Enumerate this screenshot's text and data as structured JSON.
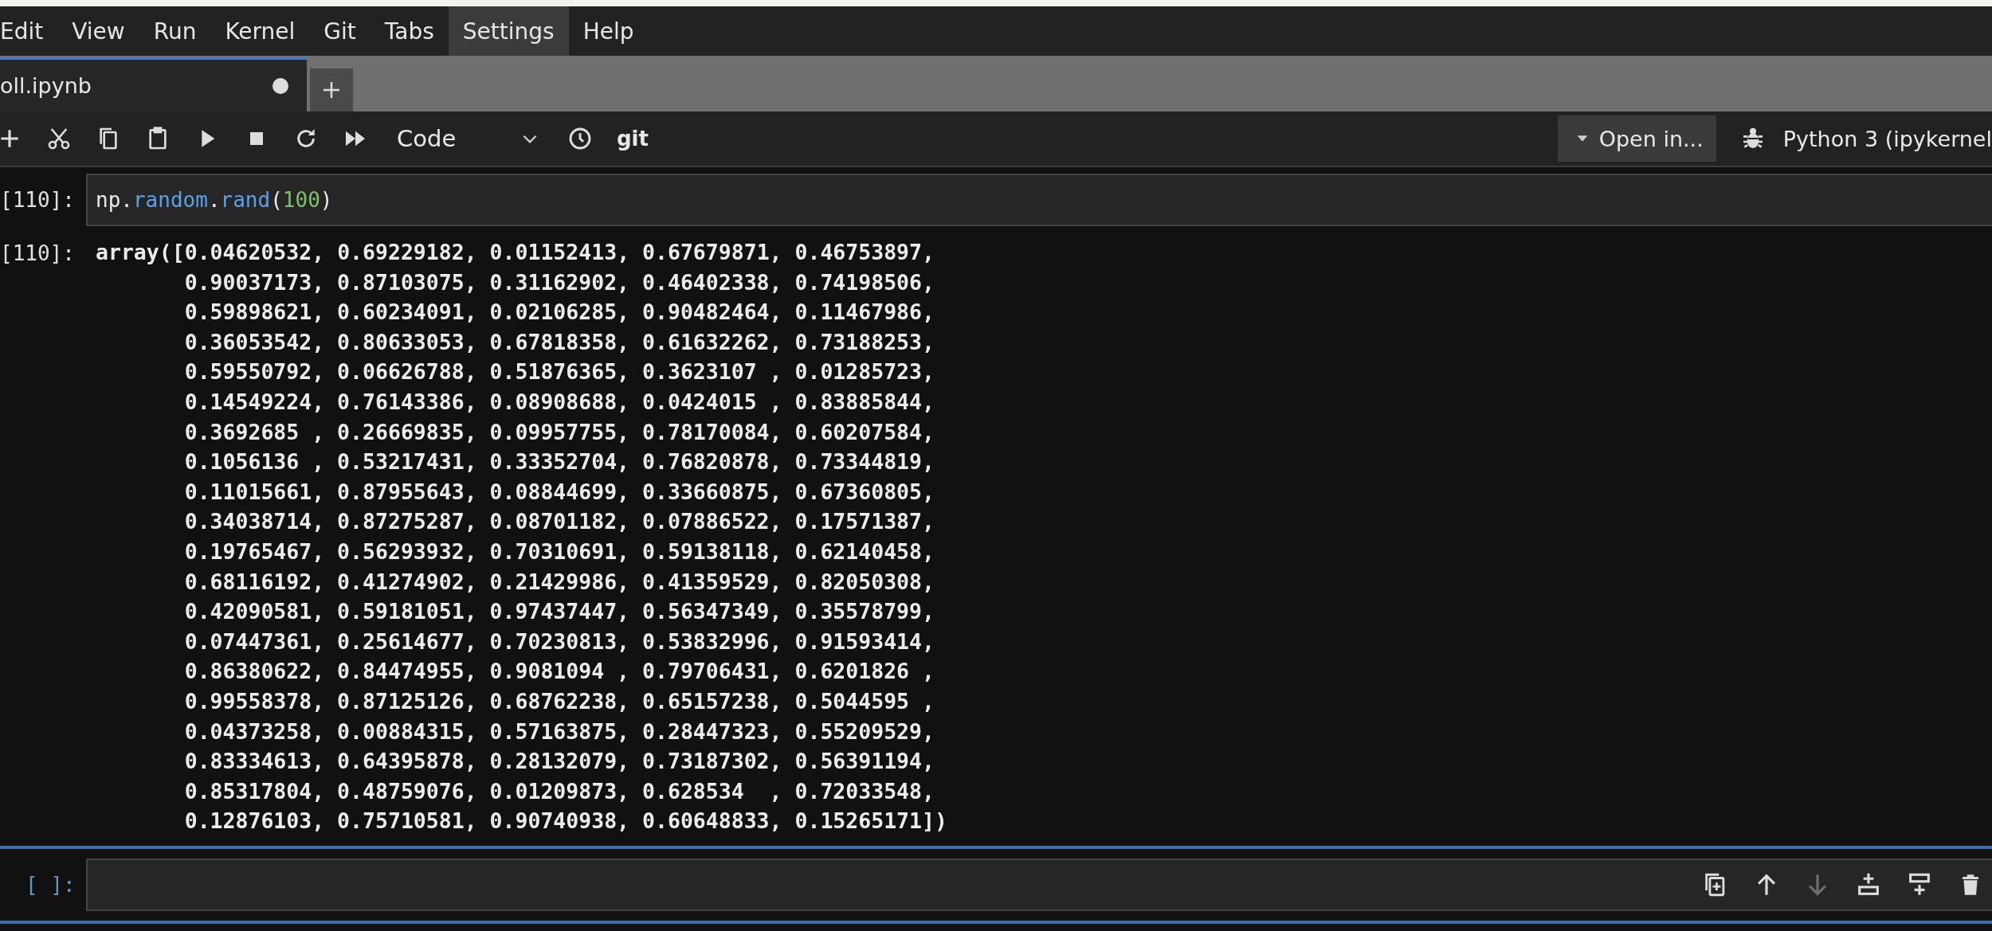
{
  "menu_bar": {
    "items": [
      {
        "label": "Edit",
        "selected": false
      },
      {
        "label": "View",
        "selected": false
      },
      {
        "label": "Run",
        "selected": false
      },
      {
        "label": "Kernel",
        "selected": false
      },
      {
        "label": "Git",
        "selected": false
      },
      {
        "label": "Tabs",
        "selected": false
      },
      {
        "label": "Settings",
        "selected": true
      },
      {
        "label": "Help",
        "selected": false
      }
    ]
  },
  "tab_bar": {
    "tabs": [
      {
        "label": "oll.ipynb",
        "selected": true,
        "unsaved": true
      }
    ]
  },
  "toolbar": {
    "tools": [
      {
        "kind": "add"
      },
      {
        "kind": "cut"
      },
      {
        "kind": "copy"
      },
      {
        "kind": "paste"
      },
      {
        "kind": "run"
      },
      {
        "kind": "stop"
      },
      {
        "kind": "restart"
      },
      {
        "kind": "run-all"
      }
    ],
    "cell_type": "Code",
    "git_label": "git",
    "open_in": "Open in...",
    "kernel": "Python 3 (ipykernel"
  },
  "cells": [
    {
      "prompt": "[110]:",
      "active": false,
      "source": [
        {
          "kind": "name",
          "text": "np"
        },
        {
          "kind": "punct",
          "text": "."
        },
        {
          "kind": "attr",
          "text": "random"
        },
        {
          "kind": "punct",
          "text": "."
        },
        {
          "kind": "attr",
          "text": "rand"
        },
        {
          "kind": "punct",
          "text": "("
        },
        {
          "kind": "number",
          "text": "100"
        },
        {
          "kind": "punct",
          "text": ")"
        }
      ],
      "output": {
        "prompt": "[110]:",
        "lines": [
          "array([0.04620532, 0.69229182, 0.01152413, 0.67679871, 0.46753897,",
          "0.90037173, 0.87103075, 0.31162902, 0.46402338, 0.74198506,",
          "0.59898621, 0.60234091, 0.02106285, 0.90482464, 0.11467986,",
          "0.36053542, 0.80633053, 0.67818358, 0.61632262, 0.73188253,",
          "0.59550792, 0.06626788, 0.51876365, 0.3623107 , 0.01285723,",
          "0.14549224, 0.76143386, 0.08908688, 0.0424015 , 0.83885844,",
          "0.3692685 , 0.26669835, 0.09957755, 0.78170084, 0.60207584,",
          "0.1056136 , 0.53217431, 0.33352704, 0.76820878, 0.73344819,",
          "0.11015661, 0.87955643, 0.08844699, 0.33660875, 0.67360805,",
          "0.34038714, 0.87275287, 0.08701182, 0.07886522, 0.17571387,",
          "0.19765467, 0.56293932, 0.70310691, 0.59138118, 0.62140458,",
          "0.68116192, 0.41274902, 0.21429986, 0.41359529, 0.82050308,",
          "0.42090581, 0.59181051, 0.97437447, 0.56347349, 0.35578799,",
          "0.07447361, 0.25614677, 0.70230813, 0.53832996, 0.91593414,",
          "0.86380622, 0.84474955, 0.9081094 , 0.79706431, 0.6201826 ,",
          "0.99558378, 0.87125126, 0.68762238, 0.65157238, 0.5044595 ,",
          "0.04373258, 0.00884315, 0.57163875, 0.28447323, 0.55209529,",
          "0.83334613, 0.64395878, 0.28132079, 0.73187302, 0.56391194,",
          "0.85317804, 0.48759076, 0.01209873, 0.628534  , 0.72033548,",
          "0.12876103, 0.75710581, 0.90740938, 0.60648833, 0.15265171])"
        ]
      }
    },
    {
      "prompt": "[ ]:",
      "active": true,
      "cell_toolbar": [
        {
          "kind": "duplicate",
          "disabled": false
        },
        {
          "kind": "move-up",
          "disabled": false
        },
        {
          "kind": "move-down",
          "disabled": true
        },
        {
          "kind": "insert-above",
          "disabled": false
        },
        {
          "kind": "insert-below",
          "disabled": false
        },
        {
          "kind": "delete",
          "disabled": false
        }
      ]
    }
  ]
}
